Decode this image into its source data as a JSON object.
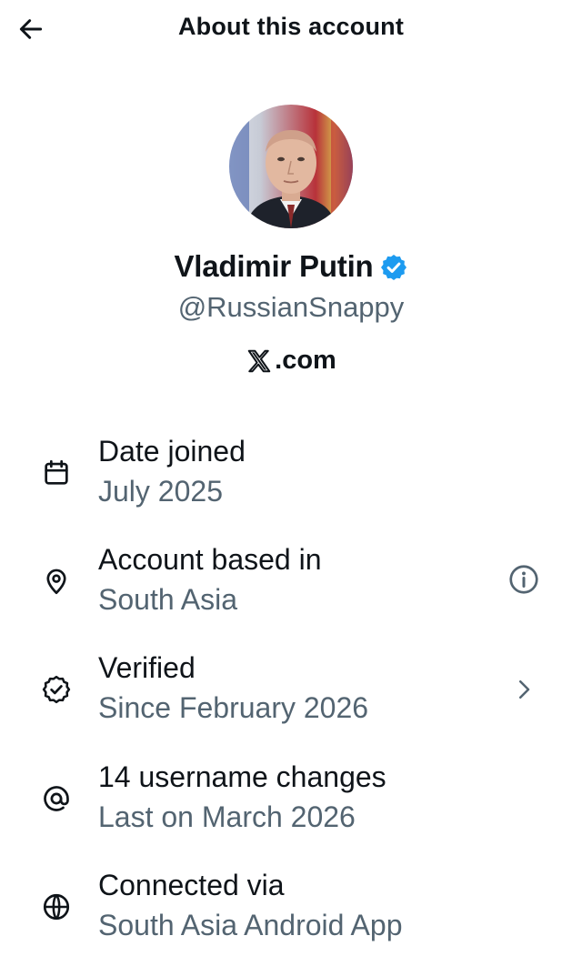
{
  "header": {
    "title": "About this account",
    "back_icon": "arrow-left-icon"
  },
  "profile": {
    "name": "Vladimir Putin",
    "handle": "@RussianSnappy",
    "verified": true,
    "verified_color": "#1d9bf0",
    "via_text": ".com",
    "via_logo": "x-logo-icon"
  },
  "rows": [
    {
      "icon": "calendar-icon",
      "label": "Date joined",
      "value": "July 2025"
    },
    {
      "icon": "location-pin-icon",
      "label": "Account based in",
      "value": "South Asia",
      "trailing_icon": "info-icon"
    },
    {
      "icon": "verified-check-icon",
      "label": "Verified",
      "value": "Since February 2026",
      "trailing_icon": "chevron-right-icon"
    },
    {
      "icon": "at-sign-icon",
      "label": "14 username changes",
      "value": "Last on March 2026"
    },
    {
      "icon": "globe-icon",
      "label": "Connected via",
      "value": "South Asia Android App"
    }
  ],
  "colors": {
    "text_primary": "#0f1419",
    "text_secondary": "#536471",
    "accent": "#1d9bf0"
  }
}
